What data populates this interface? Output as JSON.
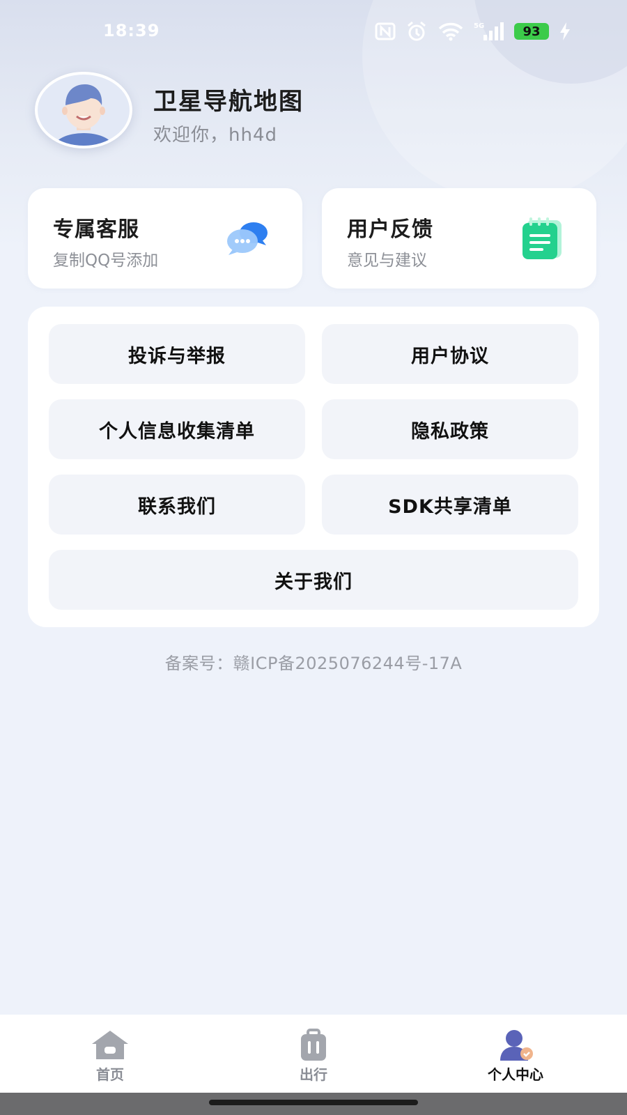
{
  "status_bar": {
    "time": "18:39",
    "battery": "93",
    "network": "5G"
  },
  "profile": {
    "app_title": "卫星导航地图",
    "welcome": "欢迎你，hh4d"
  },
  "quick_cards": {
    "service": {
      "title": "专属客服",
      "subtitle": "复制QQ号添加",
      "icon": "chat-bubble-icon"
    },
    "feedback": {
      "title": "用户反馈",
      "subtitle": "意见与建议",
      "icon": "notepad-icon"
    }
  },
  "menu": {
    "complaint": "投诉与举报",
    "user_agreement": "用户协议",
    "personal_info": "个人信息收集清单",
    "privacy": "隐私政策",
    "contact": "联系我们",
    "sdk": "SDK共享清单",
    "about": "关于我们"
  },
  "icp": "备案号：赣ICP备2025076244号-17A",
  "bottom_nav": {
    "home": "首页",
    "travel": "出行",
    "me": "个人中心",
    "active": "me"
  },
  "colors": {
    "background": "#eef2fa",
    "battery_green": "#3ccb4a",
    "feedback_icon": "#2fd89a",
    "chat_icon": "#3a8ef5",
    "nav_active": "#5a63b8"
  }
}
